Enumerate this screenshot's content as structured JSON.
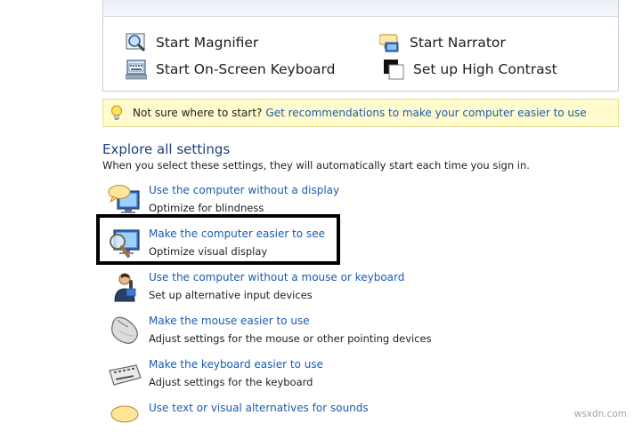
{
  "quick_access": {
    "items": [
      {
        "label": "Start Magnifier",
        "icon": "magnifier-icon"
      },
      {
        "label": "Start Narrator",
        "icon": "narrator-icon"
      },
      {
        "label": "Start On-Screen Keyboard",
        "icon": "onscreen-keyboard-icon"
      },
      {
        "label": "Set up High Contrast",
        "icon": "high-contrast-icon"
      }
    ]
  },
  "hint": {
    "text": "Not sure where to start?",
    "link": "Get recommendations to make your computer easier to use",
    "icon": "lightbulb-icon"
  },
  "explore": {
    "title": "Explore all settings",
    "description": "When you select these settings, they will automatically start each time you sign in.",
    "settings": [
      {
        "link": "Use the computer without a display",
        "sub": "Optimize for blindness",
        "icon": "speech-display-icon"
      },
      {
        "link": "Make the computer easier to see",
        "sub": "Optimize visual display",
        "icon": "magnify-monitor-icon"
      },
      {
        "link": "Use the computer without a mouse or keyboard",
        "sub": "Set up alternative input devices",
        "icon": "person-microphone-icon"
      },
      {
        "link": "Make the mouse easier to use",
        "sub": "Adjust settings for the mouse or other pointing devices",
        "icon": "mouse-icon"
      },
      {
        "link": "Make the keyboard easier to use",
        "sub": "Adjust settings for the keyboard",
        "icon": "keyboard-icon"
      },
      {
        "link": "Use text or visual alternatives for sounds",
        "sub": "",
        "icon": "speech-bubble-icon"
      }
    ]
  },
  "watermark": "wsxdn.com",
  "colors": {
    "link": "#1a5bb0",
    "hint_bg": "#fffbcc",
    "title": "#1e3f7a"
  }
}
